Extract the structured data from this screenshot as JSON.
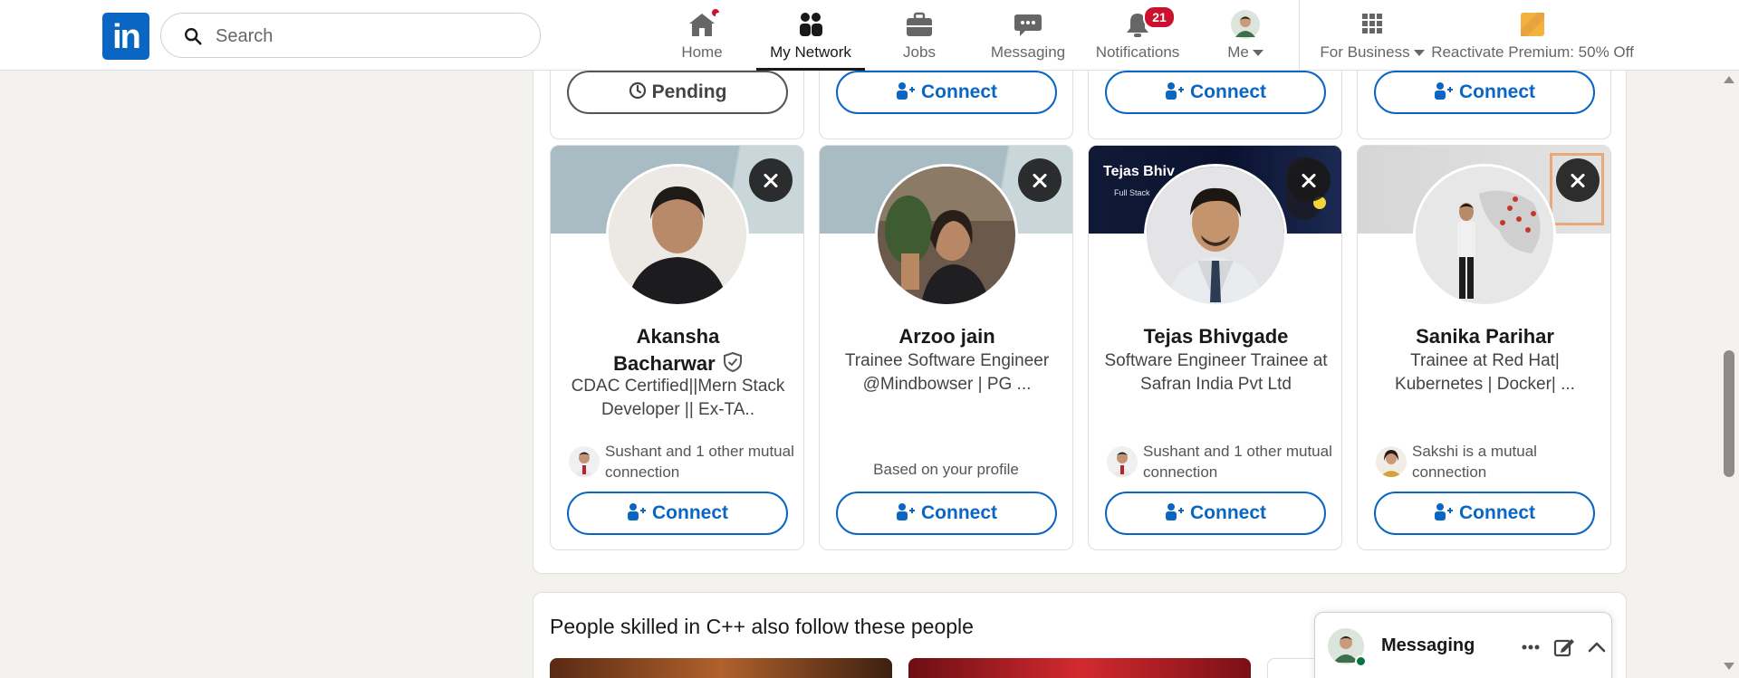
{
  "nav": {
    "logo": "in",
    "search_placeholder": "Search",
    "items": [
      {
        "label": "Home",
        "icon": "home-icon"
      },
      {
        "label": "My Network",
        "icon": "network-icon"
      },
      {
        "label": "Jobs",
        "icon": "briefcase-icon"
      },
      {
        "label": "Messaging",
        "icon": "chat-icon"
      },
      {
        "label": "Notifications",
        "icon": "bell-icon",
        "badge": "21"
      },
      {
        "label": "Me",
        "icon": "avatar"
      }
    ],
    "for_business": "For Business",
    "premium": "Reactivate Premium: 50% Off"
  },
  "top_row": {
    "buttons": [
      "Pending",
      "Connect",
      "Connect",
      "Connect"
    ]
  },
  "cards": [
    {
      "name_line1": "Akansha",
      "name_line2": "Bacharwar",
      "verified": true,
      "headline": "CDAC Certified||Mern Stack Developer || Ex-TA..",
      "mutual": "Sushant and 1 other mutual connection",
      "button": "Connect"
    },
    {
      "name": "Arzoo jain",
      "headline": "Trainee Software Engineer @Mindbowser | PG ...",
      "based": "Based on your profile",
      "button": "Connect"
    },
    {
      "name": "Tejas Bhivgade",
      "headline": "Software Engineer Trainee at Safran India Pvt Ltd",
      "mutual": "Sushant and 1 other mutual connection",
      "button": "Connect",
      "cover_title": "Tejas Bhiv",
      "cover_subtitle": "Full Stack"
    },
    {
      "name": "Sanika Parihar",
      "headline": "Trainee at Red Hat| Kubernetes | Docker| ...",
      "mutual": "Sakshi is a mutual connection",
      "button": "Connect"
    }
  ],
  "section2": {
    "title": "People skilled in C++ also follow these people"
  },
  "messaging": {
    "title": "Messaging"
  },
  "colors": {
    "brand": "#0a66c2",
    "badge": "#cb112d",
    "background": "#f4f2ee"
  }
}
